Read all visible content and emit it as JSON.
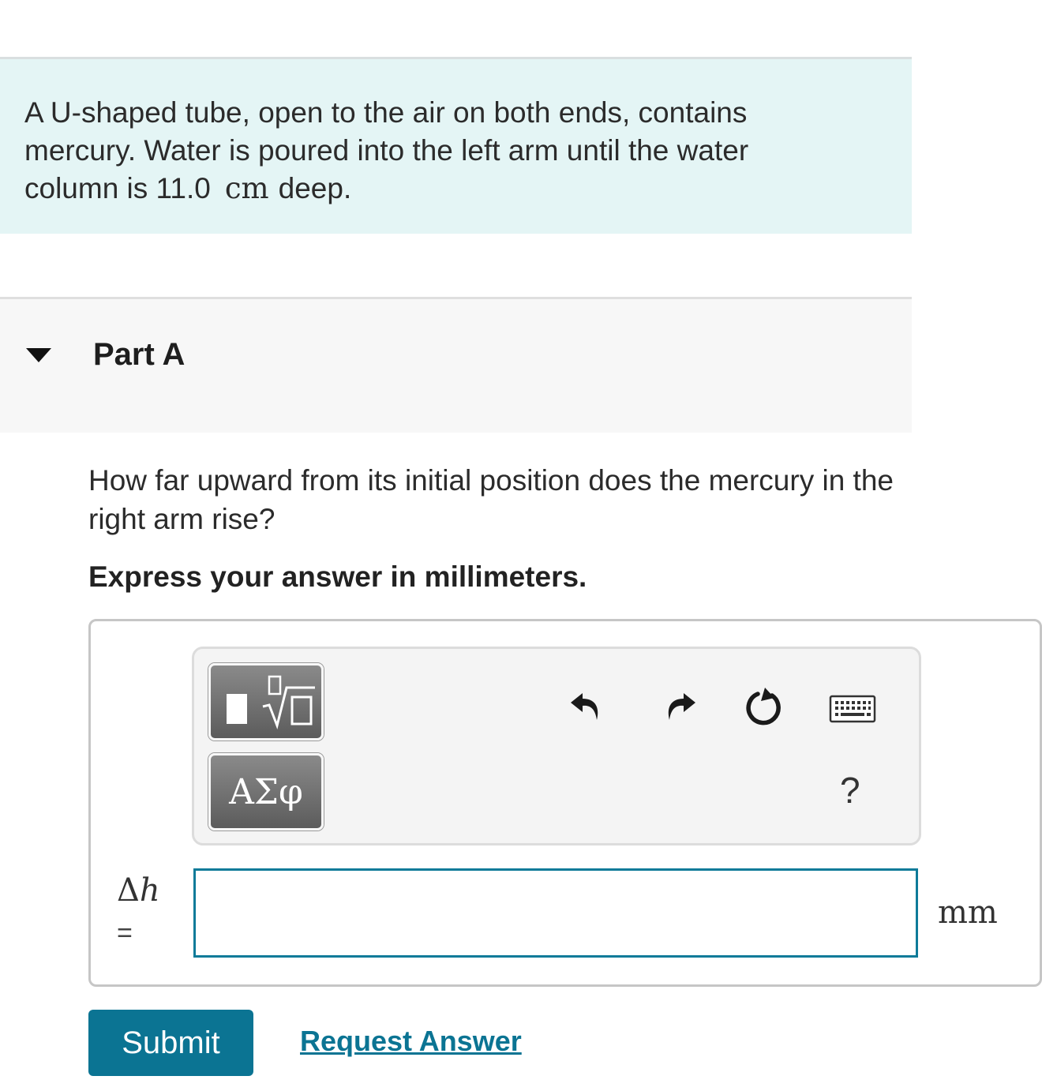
{
  "problem": {
    "text_before": "A U-shaped tube, open to the air on both ends, contains mercury. Water is poured into the left arm until the water column is 11.0",
    "unit": "cm",
    "text_after": "deep."
  },
  "part": {
    "title": "Part A",
    "expanded": true
  },
  "question": {
    "text": "How far upward from its initial position does the mercury in the right arm rise?",
    "instruction": "Express your answer in millimeters."
  },
  "toolbar": {
    "templates_icon": "templates-sqrt-icon",
    "symbols_label": "ΑΣφ",
    "undo_icon": "undo-icon",
    "redo_icon": "redo-icon",
    "reset_icon": "reset-icon",
    "keyboard_icon": "keyboard-icon",
    "help_label": "?"
  },
  "answer": {
    "variable_symbol": "Δ",
    "variable_letter": "h",
    "equals": "=",
    "value": "",
    "unit": "mm"
  },
  "actions": {
    "submit_label": "Submit",
    "request_answer_label": "Request Answer"
  },
  "colors": {
    "problem_bg": "#e4f5f5",
    "accent": "#0b7493",
    "input_border": "#0e7b99"
  }
}
